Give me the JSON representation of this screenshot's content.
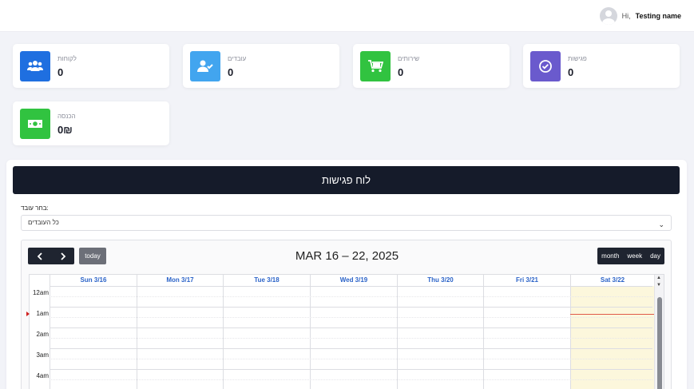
{
  "header": {
    "greeting": "Hi,",
    "user_name": "Testing name"
  },
  "stats": [
    {
      "label": "לקוחות",
      "value": "0",
      "icon": "users-icon",
      "color": "#1f6fe0"
    },
    {
      "label": "עובדים",
      "value": "0",
      "icon": "user-check-icon",
      "color": "#42a5ef"
    },
    {
      "label": "שירותים",
      "value": "0",
      "icon": "cart-icon",
      "color": "#31c340"
    },
    {
      "label": "פגישות",
      "value": "0",
      "icon": "check-circle-icon",
      "color": "#6a5acd"
    },
    {
      "label": "הכנסה",
      "value": "0₪",
      "icon": "money-icon",
      "color": "#31c340"
    }
  ],
  "board": {
    "title": "לוח פגישות",
    "employee_label": "בחר עובד:",
    "employee_selected": "כל העובדים"
  },
  "calendar": {
    "title": "MAR 16 – 22, 2025",
    "today_label": "today",
    "prev_icon": "chevron-left-icon",
    "next_icon": "chevron-right-icon",
    "views": [
      "month",
      "week",
      "day"
    ],
    "days": [
      "Sun 3/16",
      "Mon 3/17",
      "Tue 3/18",
      "Wed 3/19",
      "Thu 3/20",
      "Fri 3/21",
      "Sat 3/22"
    ],
    "times": [
      "12am",
      "1am",
      "2am",
      "3am",
      "4am"
    ],
    "today_index": 6
  }
}
